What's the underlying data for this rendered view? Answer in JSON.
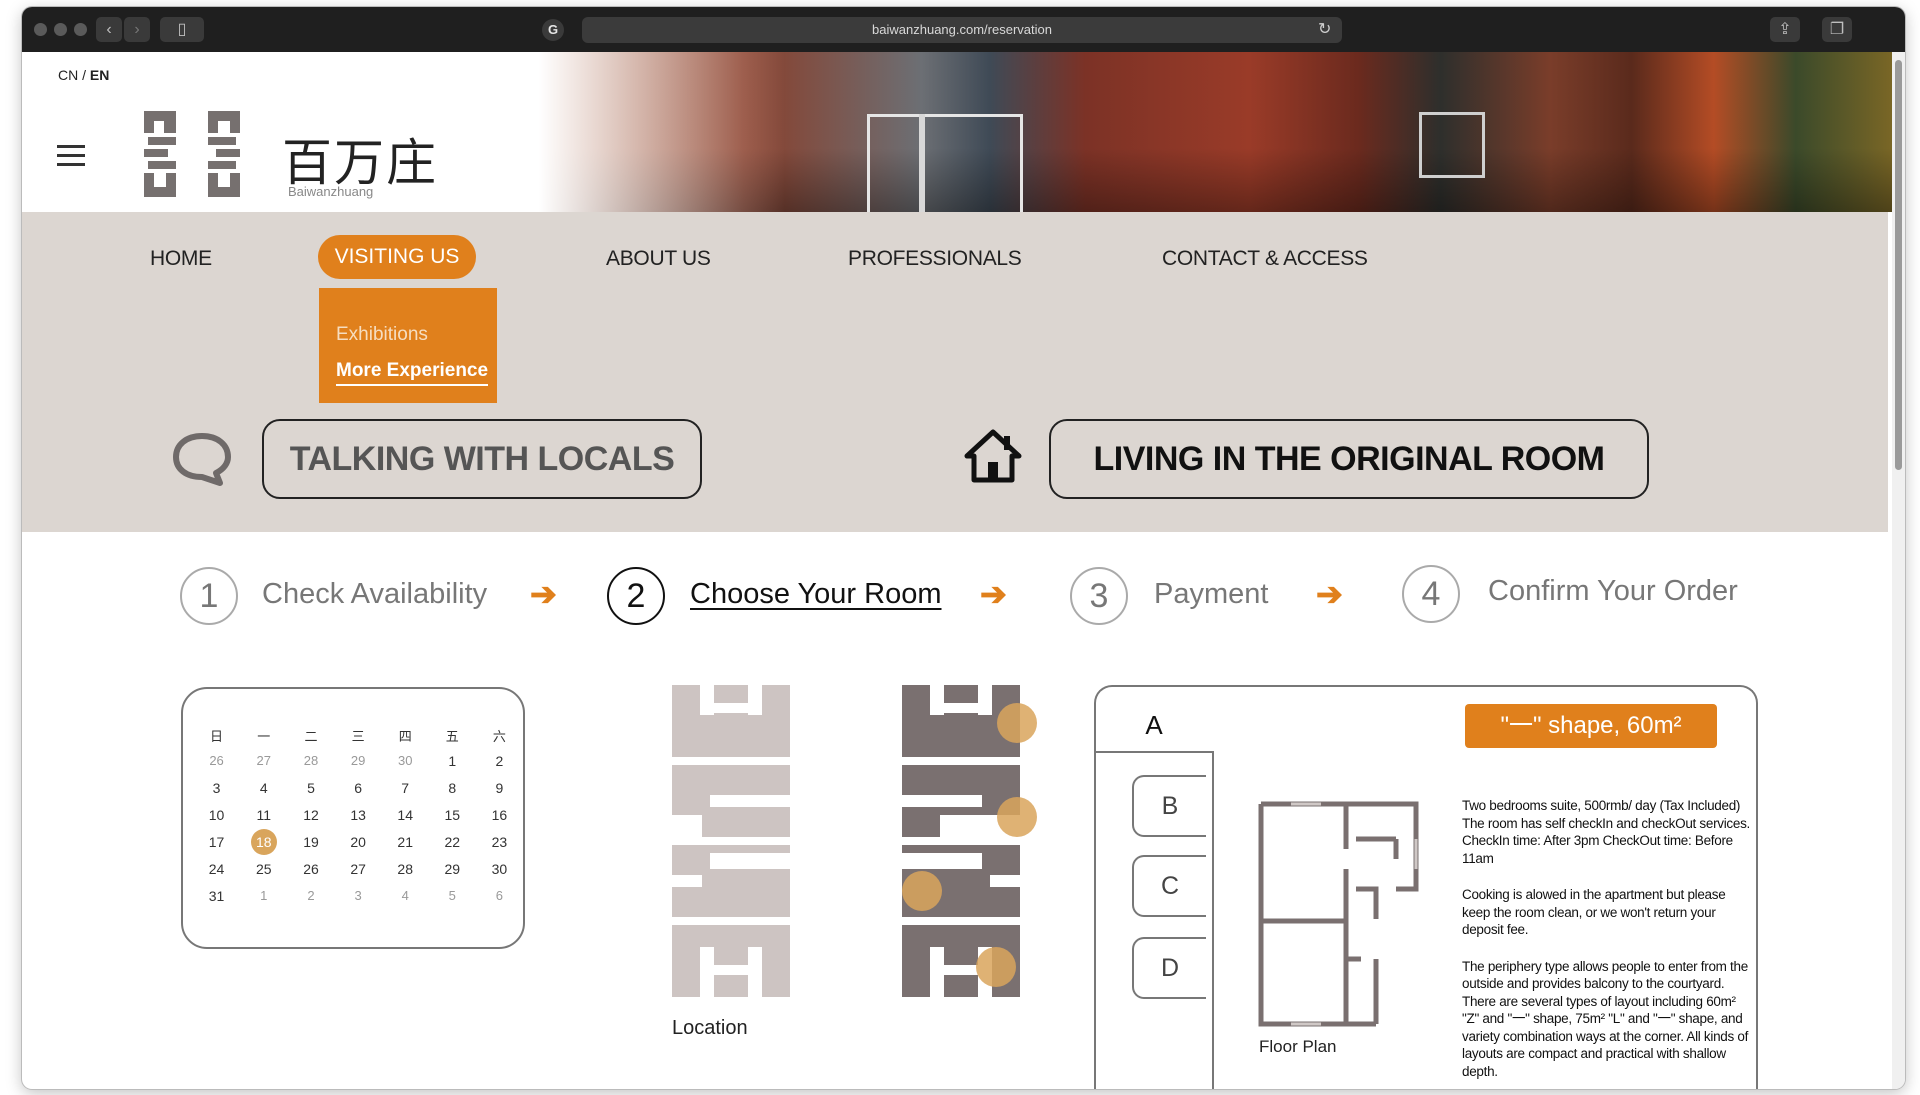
{
  "browser": {
    "url": "baiwanzhuang.com/reservation",
    "g_icon": "G"
  },
  "header": {
    "lang_cn": "CN",
    "lang_sep": "/",
    "lang_en": "EN",
    "brand_zh": "百万庄",
    "brand_en": "Baiwanzhuang"
  },
  "nav": {
    "items": [
      {
        "label": "HOME"
      },
      {
        "label": "VISITING US",
        "active": true
      },
      {
        "label": "ABOUT US"
      },
      {
        "label": "PROFESSIONALS"
      },
      {
        "label": "CONTACT & ACCESS"
      }
    ],
    "dropdown": [
      "Exhibitions",
      "More Experience"
    ]
  },
  "experience": {
    "talking": "TALKING WITH LOCALS",
    "living": "LIVING IN THE ORIGINAL ROOM"
  },
  "steps": [
    {
      "num": "1",
      "label": "Check Availability"
    },
    {
      "num": "2",
      "label": "Choose Your Room",
      "active": true
    },
    {
      "num": "3",
      "label": "Payment"
    },
    {
      "num": "4",
      "label": "Confirm Your Order"
    }
  ],
  "calendar": {
    "weekdays": [
      "日",
      "一",
      "二",
      "三",
      "四",
      "五",
      "六"
    ],
    "rows": [
      [
        "26",
        "27",
        "28",
        "29",
        "30",
        "1",
        "2"
      ],
      [
        "3",
        "4",
        "5",
        "6",
        "7",
        "8",
        "9"
      ],
      [
        "10",
        "11",
        "12",
        "13",
        "14",
        "15",
        "16"
      ],
      [
        "17",
        "18",
        "19",
        "20",
        "21",
        "22",
        "23"
      ],
      [
        "24",
        "25",
        "26",
        "27",
        "28",
        "29",
        "30"
      ],
      [
        "31",
        "1",
        "2",
        "3",
        "4",
        "5",
        "6"
      ]
    ],
    "today": "18"
  },
  "location_label": "Location",
  "room": {
    "tabs": [
      "A",
      "B",
      "C",
      "D"
    ],
    "shape": "\"一\" shape, 60m²",
    "floor_plan_label": "Floor Plan",
    "description": [
      "Two bedrooms suite, 500rmb/ day (Tax Included) The room has self checkIn and checkOut services. CheckIn time: After 3pm CheckOut time: Before 11am",
      "Cooking is alowed in the apartment but please keep the room clean, or we won't return your deposit fee.",
      "The periphery type allows people to enter from the outside and provides balcony to the courtyard. There are several types of layout including 60m² \"Z\" and \"一\" shape, 75m² \"L\" and \"一\" shape, and variety combination ways at the corner. All kinds of layouts are compact and practical with shallow depth."
    ]
  },
  "colors": {
    "accent": "#e0801c",
    "band": "#dcd6d1",
    "map_light": "#cdc4c2",
    "map_dark": "#7a7070",
    "marker": "#d9a55c"
  }
}
